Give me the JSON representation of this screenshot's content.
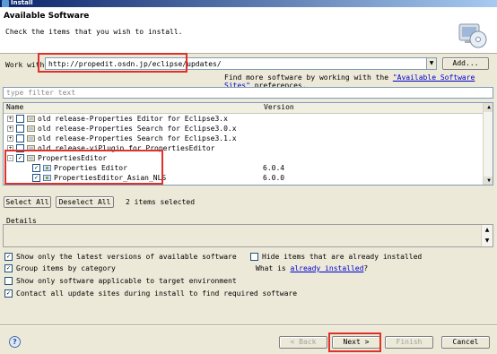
{
  "window": {
    "title": "Install"
  },
  "header": {
    "title": "Available Software",
    "description": "Check the items that you wish to install."
  },
  "workwith": {
    "label": "Work with:",
    "value": "http://propedit.osdn.jp/eclipse/updates/",
    "add_label": "Add..."
  },
  "findmore": {
    "prefix": "Find more software by working with the ",
    "link": "\"Available Software Sites\"",
    "suffix": " preferences."
  },
  "filter": {
    "placeholder": "type filter text"
  },
  "tree": {
    "columns": [
      "Name",
      "Version"
    ],
    "rows": [
      {
        "name": "old release-Properties Editor for Eclipse3.x",
        "version": "",
        "level": 0,
        "expander": "+",
        "checked": false
      },
      {
        "name": "old release-Properties Search for Eclipse3.0.x",
        "version": "",
        "level": 0,
        "expander": "+",
        "checked": false
      },
      {
        "name": "old release-Properties Search for Eclipse3.1.x",
        "version": "",
        "level": 0,
        "expander": "+",
        "checked": false
      },
      {
        "name": "old release-viPlugin for PropertiesEditor",
        "version": "",
        "level": 0,
        "expander": "+",
        "checked": false
      },
      {
        "name": "PropertiesEditor",
        "version": "",
        "level": 0,
        "expander": "-",
        "checked": true
      },
      {
        "name": "Properties Editor",
        "version": "6.0.4",
        "level": 1,
        "expander": "",
        "checked": true
      },
      {
        "name": "PropertiesEditor_Asian_NLS",
        "version": "6.0.0",
        "level": 1,
        "expander": "",
        "checked": true
      }
    ]
  },
  "selection": {
    "select_all": "Select All",
    "deselect_all": "Deselect All",
    "count_text": "2 items selected"
  },
  "details": {
    "label": "Details"
  },
  "options": {
    "latest_only": {
      "label": "Show only the latest versions of available software",
      "checked": true
    },
    "group_by_category": {
      "label": "Group items by category",
      "checked": true
    },
    "applicable_only": {
      "label": "Show only software applicable to target environment",
      "checked": false
    },
    "contact_all": {
      "label": "Contact all update sites during install to find required software",
      "checked": true
    },
    "hide_installed": {
      "label": "Hide items that are already installed",
      "checked": false
    },
    "whatis_prefix": "What is ",
    "whatis_link": "already installed",
    "whatis_suffix": "?"
  },
  "buttons": {
    "help": "?",
    "back": "< Back",
    "next": "Next >",
    "finish": "Finish",
    "cancel": "Cancel"
  },
  "colors": {
    "highlight_red": "#e0302a",
    "link": "#0000cc",
    "title_bar": "#0a246a"
  }
}
